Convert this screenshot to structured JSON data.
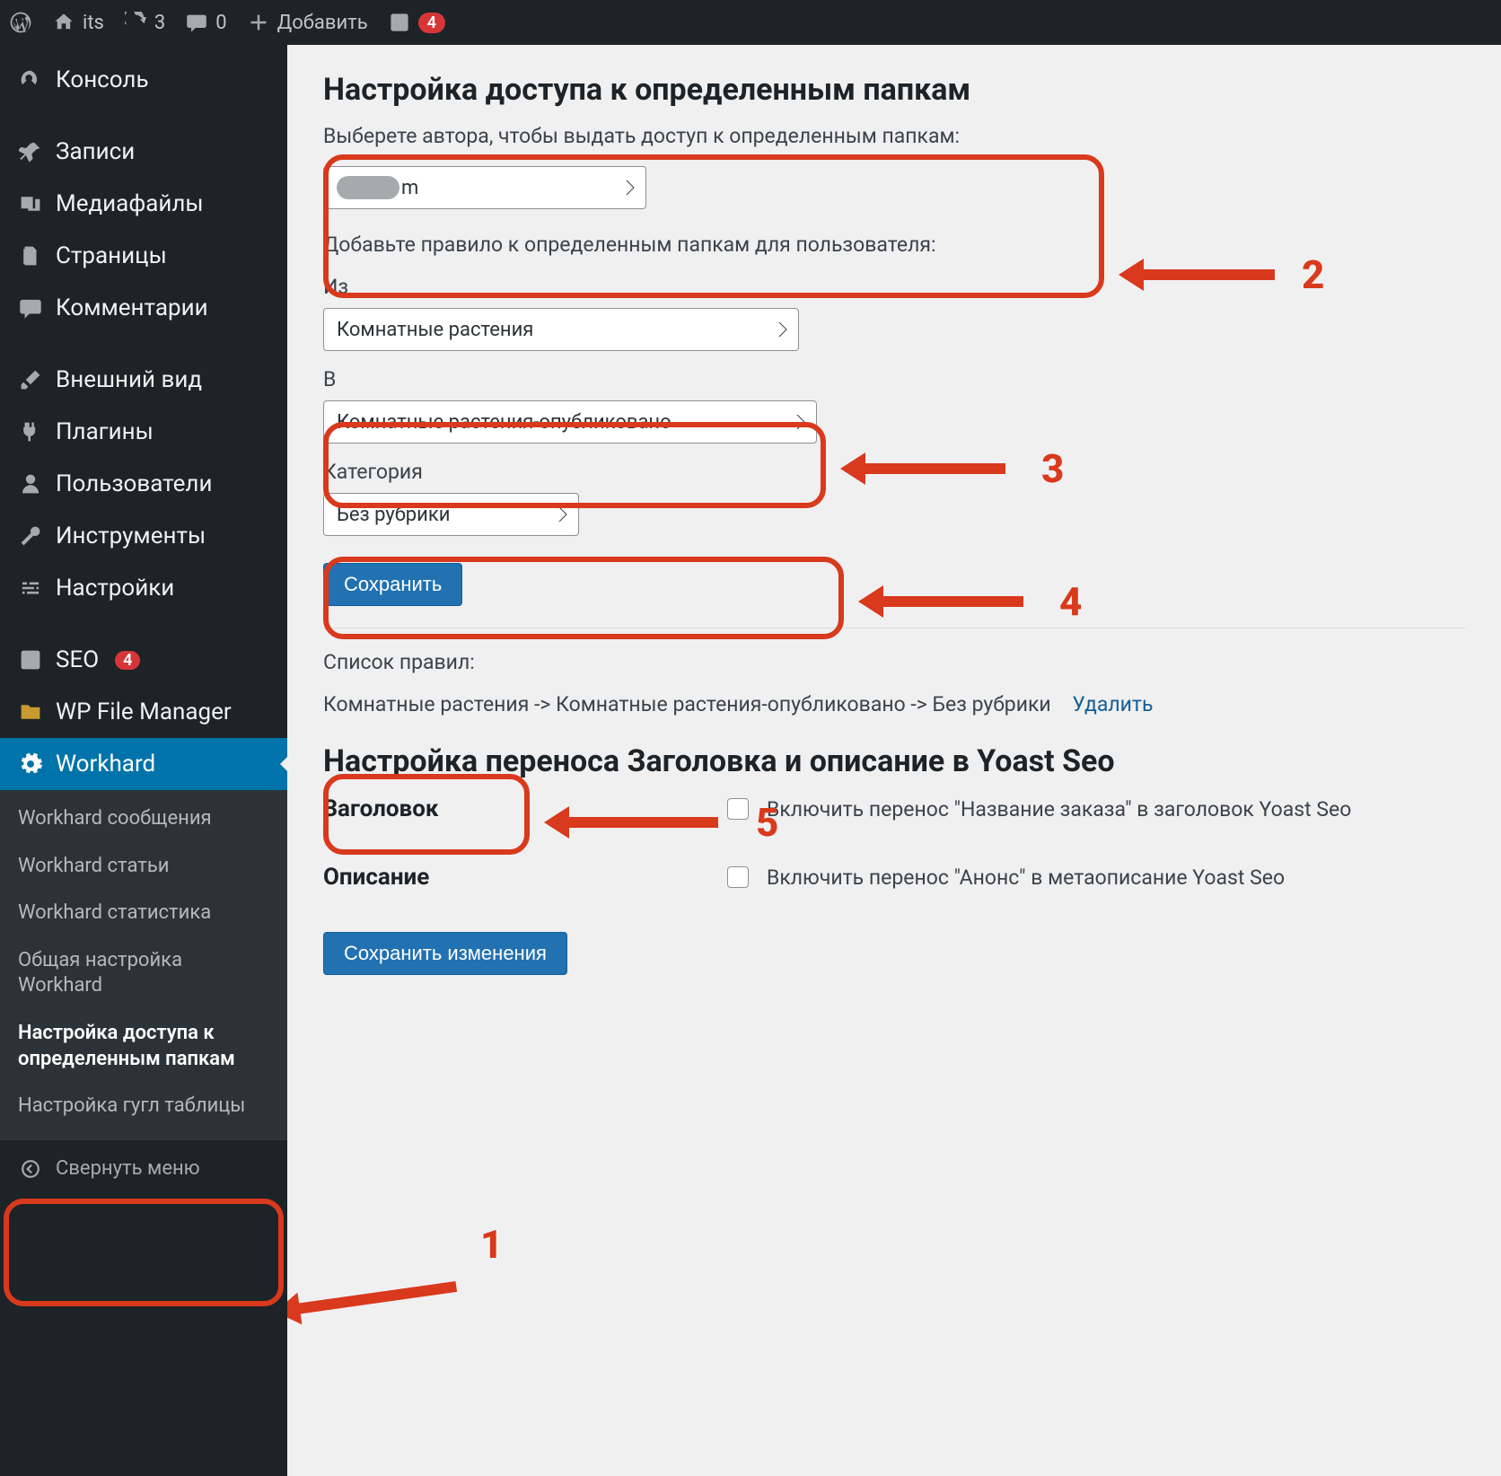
{
  "adminbar": {
    "site_name": "its",
    "updates_count": "3",
    "comments_count": "0",
    "add_new": "Добавить",
    "yoast_badge": "4"
  },
  "sidebar": {
    "dashboard": "Консоль",
    "posts": "Записи",
    "media": "Медиафайлы",
    "pages": "Страницы",
    "comments": "Комментарии",
    "appearance": "Внешний вид",
    "plugins": "Плагины",
    "users": "Пользователи",
    "tools": "Инструменты",
    "settings": "Настройки",
    "seo": "SEO",
    "seo_badge": "4",
    "wpfm": "WP File Manager",
    "workhard": "Workhard",
    "submenu": {
      "messages": "Workhard сообщения",
      "articles": "Workhard статьи",
      "stats": "Workhard статистика",
      "general": "Общая настройка Workhard",
      "folder_access": "Настройка доступа к определенным папкам",
      "gsheets": "Настройка гугл таблицы"
    },
    "collapse": "Свернуть меню"
  },
  "page": {
    "title1": "Настройка доступа к определенным папкам",
    "hint_author": "Выберете автора, чтобы выдать доступ к определенным папкам:",
    "author_suffix": "m",
    "hint_rule": "Добавьте правило к определенным папкам для пользователя:",
    "label_from": "Из",
    "from_value": "Комнатные растения",
    "label_to": "В",
    "to_value": "Комнатные растения-опубликовано",
    "label_cat": "Категория",
    "cat_value": "Без рубрики",
    "save_btn": "Сохранить",
    "rules_list_label": "Список правил:",
    "rule_text": "Комнатные растения -> Комнатные растения-опубликовано -> Без рубрики",
    "rule_delete": "Удалить",
    "title2": "Настройка переноса Заголовка и описание в Yoast Seo",
    "row1_label": "Заголовок",
    "row1_chk_label": "Включить перенос \"Название заказа\" в заголовок Yoast Seo",
    "row2_label": "Описание",
    "row2_chk_label": "Включить перенос \"Анонс\" в метаописание Yoast Seo",
    "save_changes": "Сохранить изменения"
  },
  "callouts": {
    "n1": "1",
    "n2": "2",
    "n3": "3",
    "n4": "4",
    "n5": "5"
  }
}
